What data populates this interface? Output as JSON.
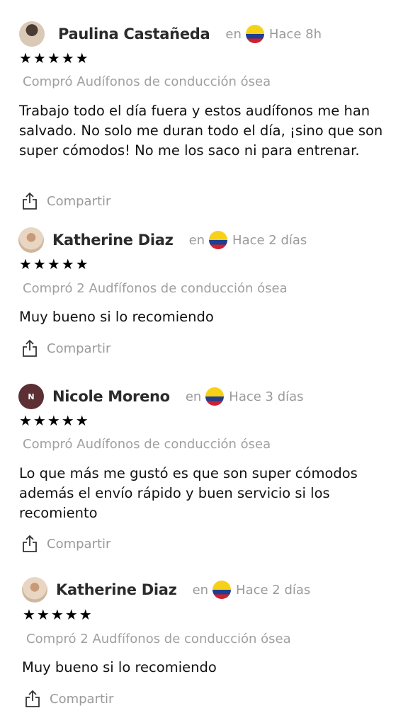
{
  "reviews": [
    {
      "name": "Paulina Castañeda",
      "en": "en",
      "time": "Hace 8h",
      "stars": "★★★★★",
      "product": "Compró Audífonos de conducción ósea",
      "body": "Trabajo todo el día fuera y estos audífonos me han salvado. No solo me duran todo el día, ¡sino que son super cómodos! No me los saco ni para entrenar.",
      "share": "Compartir",
      "rating": 5
    },
    {
      "name": "Katherine Diaz",
      "en": "en",
      "time": "Hace 2 días",
      "stars": "★★★★★",
      "product": "Compró 2 Audfífonos de conducción ósea",
      "body": "Muy bueno si lo recomiendo",
      "share": "Compartir",
      "rating": 5
    },
    {
      "name": "Nicole Moreno",
      "avatar_letter": "N",
      "en": "en",
      "time": "Hace 3 días",
      "stars": "★★★★★",
      "product": "Compró Audífonos de conducción ósea",
      "body": "Lo que más me gustó es que son super cómodos además el envío rápido y buen servicio si los recomiento",
      "share": "Compartir",
      "rating": 5
    },
    {
      "name": "Katherine Diaz",
      "en": "en",
      "time": "Hace 2 días",
      "stars": "★★★★★",
      "product": "Compró 2 Audfífonos de conducción ósea",
      "body": "Muy bueno si lo recomiendo",
      "share": "Compartir",
      "rating": 5
    }
  ],
  "colors": {
    "avatar_letter_bg": "#5b2f34",
    "muted_text": "#9a9a9a",
    "name_text": "#2b2b2b"
  },
  "icons": {
    "share": "share-icon",
    "flag": "colombia-flag-icon"
  }
}
